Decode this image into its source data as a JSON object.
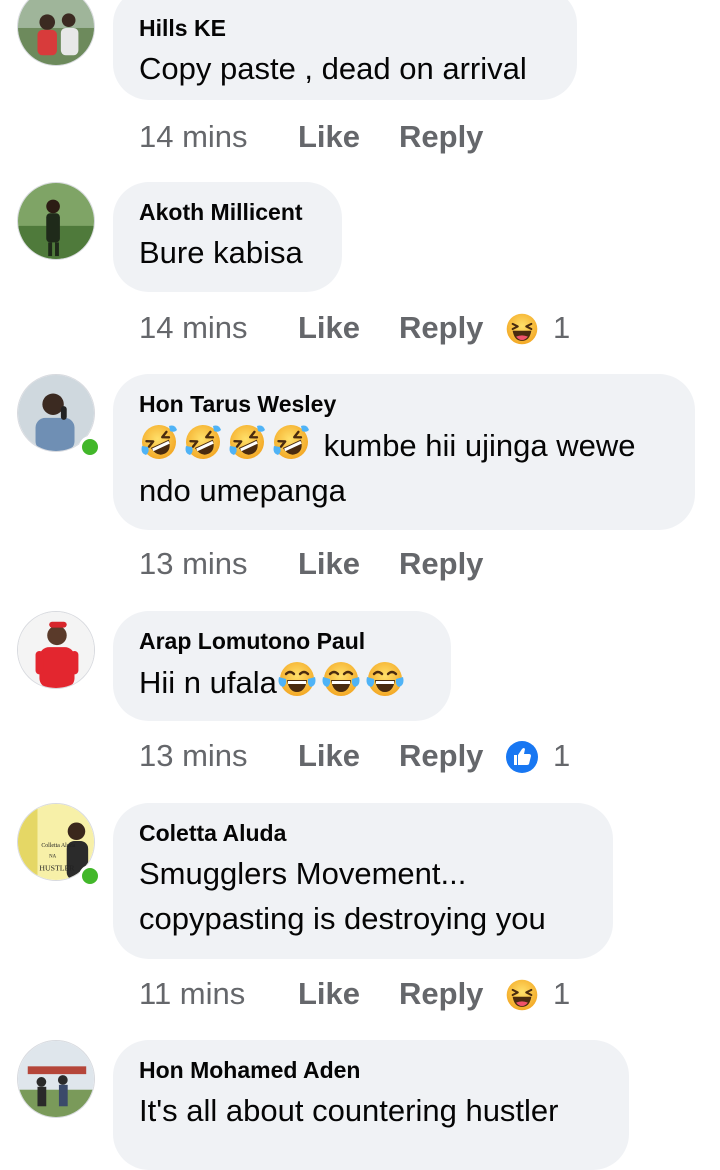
{
  "comments": [
    {
      "author": "Hills KE",
      "text": "Copy paste , dead on arrival",
      "time": "14 mins",
      "like_label": "Like",
      "reply_label": "Reply",
      "online": false,
      "reaction": null
    },
    {
      "author": "Akoth Millicent",
      "text": "Bure kabisa",
      "time": "14 mins",
      "like_label": "Like",
      "reply_label": "Reply",
      "online": false,
      "reaction": {
        "icon": "laughing-squint-emoji-icon",
        "count": "1"
      }
    },
    {
      "author": "Hon Tarus Wesley",
      "text_line1": "kumbe hii ujinga wewe",
      "text_line2": "ndo umepanga",
      "emojis_before_text": [
        "rolling-laughing-emoji-icon",
        "rolling-laughing-emoji-icon",
        "rolling-laughing-emoji-icon",
        "rolling-laughing-emoji-icon"
      ],
      "time": "13 mins",
      "like_label": "Like",
      "reply_label": "Reply",
      "online": true,
      "reaction": null
    },
    {
      "author": "Arap Lomutono Paul",
      "text": "Hii n ufala",
      "emojis_after_text": [
        "tears-of-joy-emoji-icon",
        "tears-of-joy-emoji-icon",
        "tears-of-joy-emoji-icon"
      ],
      "time": "13 mins",
      "like_label": "Like",
      "reply_label": "Reply",
      "online": false,
      "reaction": {
        "icon": "like-thumb-icon",
        "count": "1"
      }
    },
    {
      "author": "Coletta Aluda",
      "text_line1": "Smugglers Movement...",
      "text_line2": "copypasting is destroying you",
      "avatar_text": [
        "Colletta Aluda",
        "NA",
        "HUSTLER"
      ],
      "time": "11 mins",
      "like_label": "Like",
      "reply_label": "Reply",
      "online": true,
      "reaction": {
        "icon": "laughing-squint-emoji-icon",
        "count": "1"
      }
    },
    {
      "author": "Hon Mohamed Aden",
      "text": "It's all about countering hustler",
      "online": false
    }
  ],
  "colors": {
    "bubble": "#f0f2f5",
    "meta_text": "#65676b",
    "online": "#42b72a",
    "like_blue": "#1877f2",
    "emoji_yellow": "#f7c22d"
  }
}
